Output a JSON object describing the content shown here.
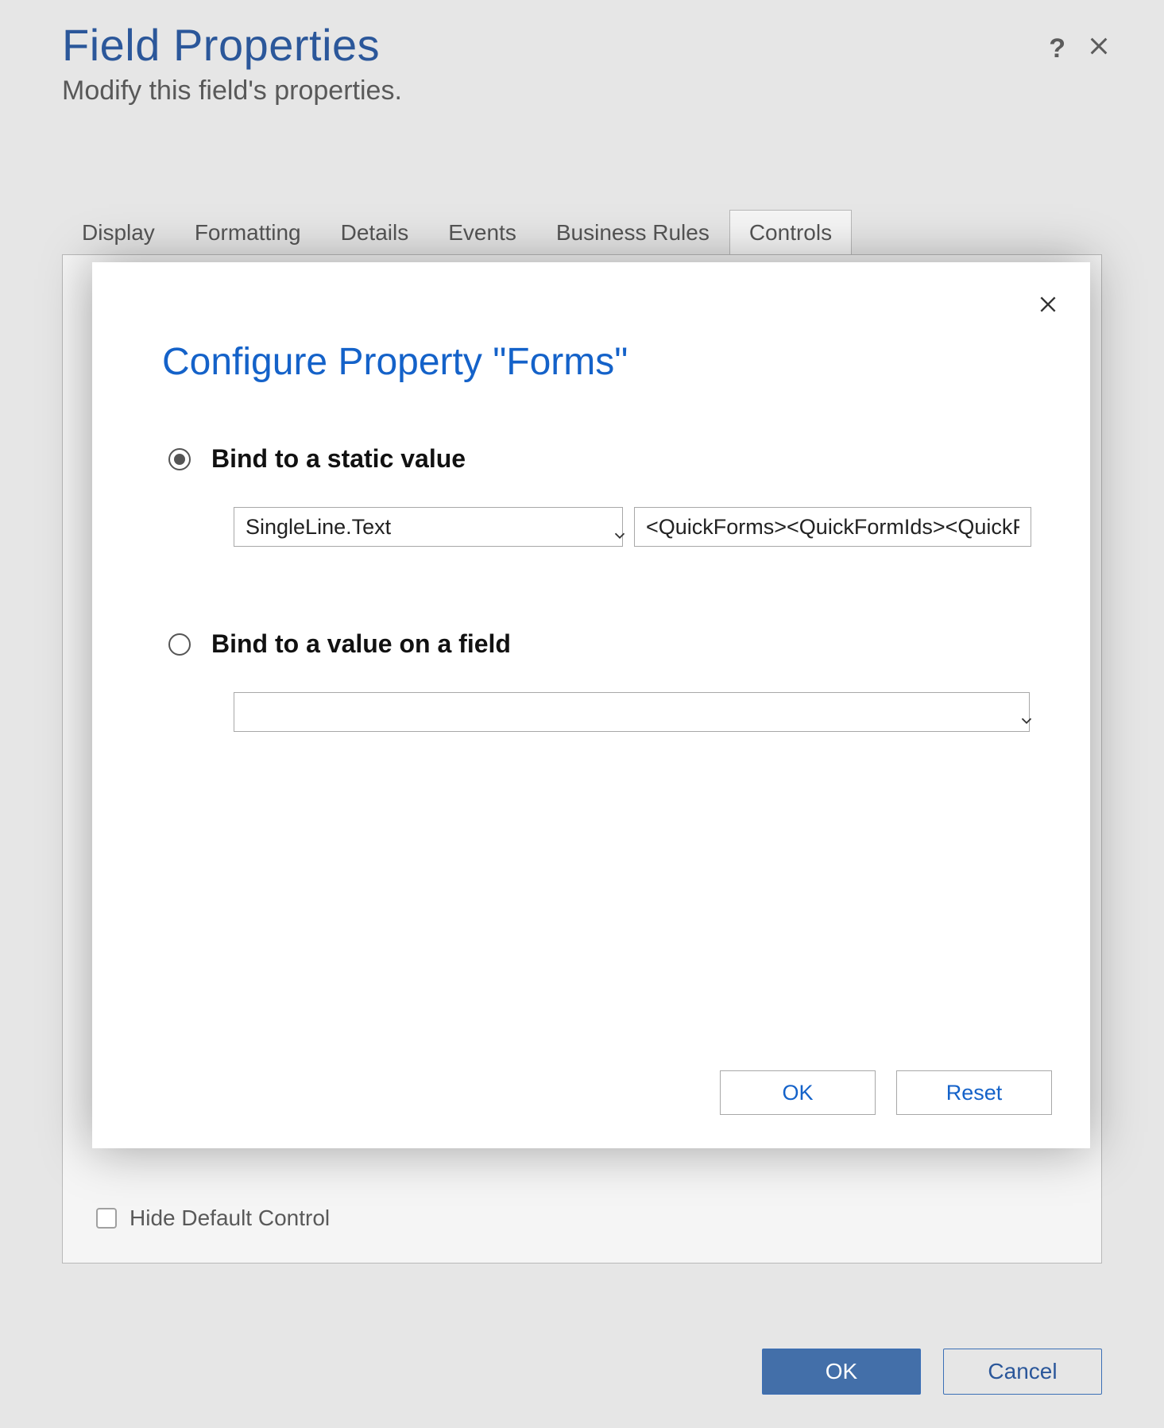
{
  "header": {
    "title": "Field Properties",
    "subtitle": "Modify this field's properties."
  },
  "tabs": {
    "items": [
      {
        "label": "Display"
      },
      {
        "label": "Formatting"
      },
      {
        "label": "Details"
      },
      {
        "label": "Events"
      },
      {
        "label": "Business Rules"
      },
      {
        "label": "Controls"
      }
    ]
  },
  "panel": {
    "hide_default_label": "Hide Default Control"
  },
  "footer": {
    "ok": "OK",
    "cancel": "Cancel"
  },
  "modal": {
    "title": "Configure Property \"Forms\"",
    "option_static_label": "Bind to a static value",
    "static_type_value": "SingleLine.Text",
    "static_text_value": "<QuickForms><QuickFormIds><QuickFo",
    "option_field_label": "Bind to a value on a field",
    "field_select_value": "",
    "ok": "OK",
    "reset": "Reset"
  }
}
